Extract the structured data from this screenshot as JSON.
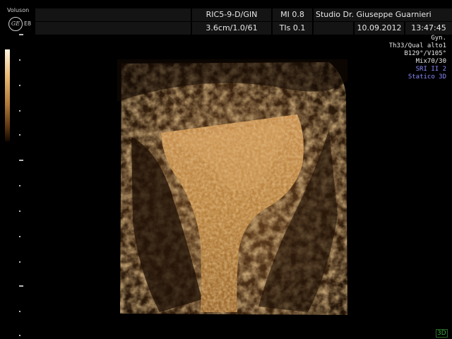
{
  "device": {
    "brand": "Voluson",
    "model_sub": "E8",
    "logo": "GE"
  },
  "header": {
    "probe": "RIC5-9-D/GIN",
    "mi": "MI  0.8",
    "clinic": "Studio Dr. Giuseppe Guarnieri",
    "depth_info": "3.6cm/1.0/61",
    "tis": "TIs  0.1",
    "date": "10.09.2012",
    "time": "13:47:45"
  },
  "parameters": {
    "preset": "Gyn.",
    "quality": "Th33/Qual alto1",
    "angles": "B129°/V105°",
    "mix": "Mix70/30",
    "sri": "SRI II 2",
    "mode": "Statico 3D"
  },
  "colors": {
    "header_bg": "#141414",
    "param_text": "#e8e8e8",
    "sri_text": "#8a8aff",
    "mode_text": "#8a8aff",
    "badge_green": "#3fa83f",
    "tissue_amber": "#c08848"
  },
  "badge": {
    "label": "3D"
  }
}
